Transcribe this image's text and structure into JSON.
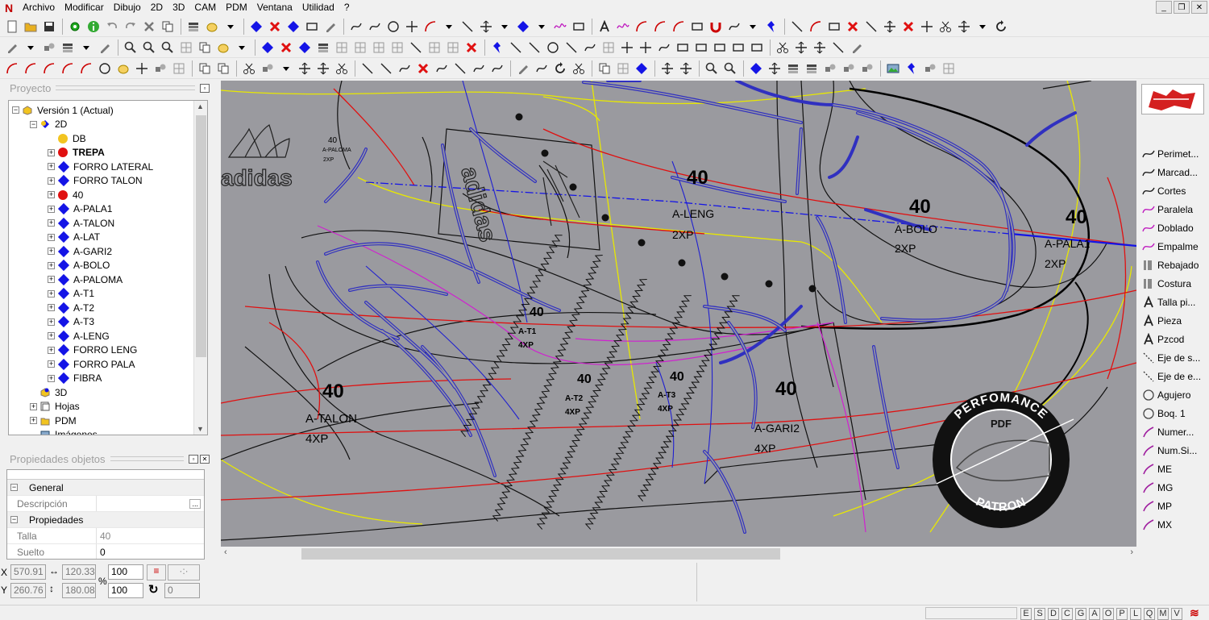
{
  "menubar": {
    "items": [
      "Archivo",
      "Modificar",
      "Dibujo",
      "2D",
      "3D",
      "CAM",
      "PDM",
      "Ventana",
      "Utilidad",
      "?"
    ]
  },
  "proyecto": {
    "title": "Proyecto",
    "tree": [
      {
        "label": "Versión 1 (Actual)",
        "icon": "version-box-icon"
      },
      {
        "label": "2D",
        "icon": "layer-2d-icon"
      },
      {
        "label": "DB",
        "icon": "yellow-dot-icon"
      },
      {
        "label": "TREPA",
        "icon": "red-dot-icon"
      },
      {
        "label": "FORRO LATERAL",
        "icon": "blue-diamond-icon"
      },
      {
        "label": "FORRO TALON",
        "icon": "blue-diamond-icon"
      },
      {
        "label": "40",
        "icon": "red-dot-icon"
      },
      {
        "label": "A-PALA1",
        "icon": "blue-diamond-icon"
      },
      {
        "label": "A-TALON",
        "icon": "blue-diamond-icon"
      },
      {
        "label": "A-LAT",
        "icon": "blue-diamond-icon"
      },
      {
        "label": "A-GARI2",
        "icon": "blue-diamond-icon"
      },
      {
        "label": "A-BOLO",
        "icon": "blue-diamond-icon"
      },
      {
        "label": "A-PALOMA",
        "icon": "blue-diamond-icon"
      },
      {
        "label": "A-T1",
        "icon": "blue-diamond-icon"
      },
      {
        "label": "A-T2",
        "icon": "blue-diamond-icon"
      },
      {
        "label": "A-T3",
        "icon": "blue-diamond-icon"
      },
      {
        "label": "A-LENG",
        "icon": "blue-diamond-icon"
      },
      {
        "label": "FORRO LENG",
        "icon": "blue-diamond-icon"
      },
      {
        "label": "FORRO PALA",
        "icon": "blue-diamond-icon"
      },
      {
        "label": "FIBRA",
        "icon": "blue-diamond-icon"
      },
      {
        "label": "3D",
        "icon": "layer-3d-icon"
      },
      {
        "label": "Hojas",
        "icon": "sheets-icon"
      },
      {
        "label": "PDM",
        "icon": "folder-icon"
      },
      {
        "label": "Imágenes",
        "icon": "images-icon"
      }
    ]
  },
  "propiedades": {
    "title": "Propiedades objetos",
    "sections": {
      "general": "General",
      "propiedades": "Propiedades"
    },
    "rows": {
      "descripcion": {
        "label": "Descripción",
        "value": "",
        "btn": "..."
      },
      "talla": {
        "label": "Talla",
        "value": "40"
      },
      "suelto": {
        "label": "Suelto",
        "value": "0"
      }
    }
  },
  "canvas": {
    "pieces": [
      {
        "size": "40",
        "name": "A-LENG",
        "qty": "2XP"
      },
      {
        "size": "40",
        "name": "A-BOLO",
        "qty": "2XP"
      },
      {
        "size": "40",
        "name": "A-PALA1",
        "qty": "2XP"
      },
      {
        "size": "40",
        "name": "A-T1",
        "qty": "4XP"
      },
      {
        "size": "40",
        "name": "A-T2",
        "qty": "4XP"
      },
      {
        "size": "40",
        "name": "A-T3",
        "qty": "4XP"
      },
      {
        "size": "40",
        "name": "A-TALON",
        "qty": "4XP"
      },
      {
        "size": "40",
        "name": "A-GARI2",
        "qty": "4XP"
      },
      {
        "size": "40",
        "name": "A-PALOMA",
        "qty": "2XP"
      }
    ],
    "brand_text": "adidas",
    "brand_text_inner": "adidas",
    "watermark": {
      "top": "PERFOMANCE",
      "center": "PDF",
      "bottom": "PATRON"
    }
  },
  "tools": [
    "Perimet...",
    "Marcad...",
    "Cortes",
    "Paralela",
    "Doblado",
    "Empalme",
    "Rebajado",
    "Costura",
    "Talla pi...",
    "Pieza",
    "Pzcod",
    "Eje de s...",
    "Eje de e...",
    "Agujero",
    "Boq. 1",
    "Numer...",
    "Num.Si...",
    "ME",
    "MG",
    "MP",
    "MX"
  ],
  "coords": {
    "x_label": "X",
    "x": "570.91",
    "dx": "120.33",
    "pct1": "100",
    "y_label": "Y",
    "y": "260.76",
    "dy": "180.08",
    "pct2": "100",
    "angle": "0",
    "percent_sign": "%"
  },
  "status": {
    "letters": [
      "E",
      "S",
      "D",
      "C",
      "G",
      "A",
      "O",
      "P",
      "L",
      "Q",
      "M",
      "V"
    ]
  },
  "colors": {
    "canvas_bg": "#9a9a9f",
    "accent_blue": "#1414e6",
    "accent_red": "#e01010",
    "piece_line": "#3838c8"
  }
}
